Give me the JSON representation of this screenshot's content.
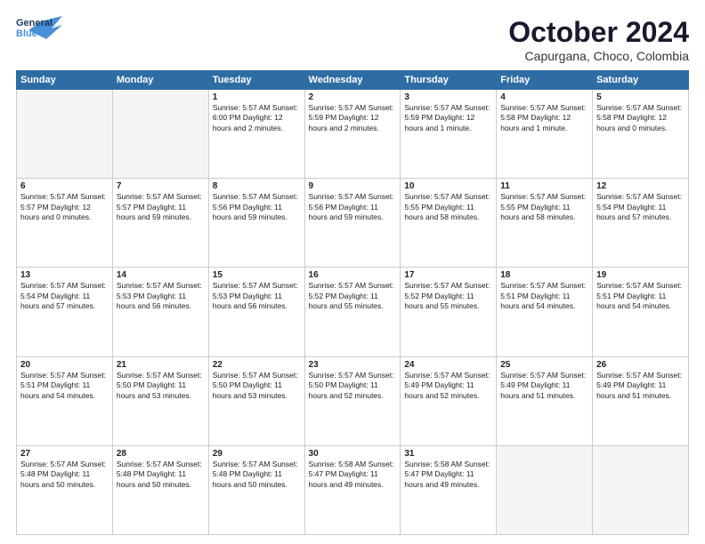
{
  "header": {
    "logo_general": "General",
    "logo_blue": "Blue",
    "month": "October 2024",
    "location": "Capurgana, Choco, Colombia"
  },
  "days_of_week": [
    "Sunday",
    "Monday",
    "Tuesday",
    "Wednesday",
    "Thursday",
    "Friday",
    "Saturday"
  ],
  "weeks": [
    [
      {
        "day": "",
        "info": ""
      },
      {
        "day": "",
        "info": ""
      },
      {
        "day": "1",
        "info": "Sunrise: 5:57 AM\nSunset: 6:00 PM\nDaylight: 12 hours\nand 2 minutes."
      },
      {
        "day": "2",
        "info": "Sunrise: 5:57 AM\nSunset: 5:59 PM\nDaylight: 12 hours\nand 2 minutes."
      },
      {
        "day": "3",
        "info": "Sunrise: 5:57 AM\nSunset: 5:59 PM\nDaylight: 12 hours\nand 1 minute."
      },
      {
        "day": "4",
        "info": "Sunrise: 5:57 AM\nSunset: 5:58 PM\nDaylight: 12 hours\nand 1 minute."
      },
      {
        "day": "5",
        "info": "Sunrise: 5:57 AM\nSunset: 5:58 PM\nDaylight: 12 hours\nand 0 minutes."
      }
    ],
    [
      {
        "day": "6",
        "info": "Sunrise: 5:57 AM\nSunset: 5:57 PM\nDaylight: 12 hours\nand 0 minutes."
      },
      {
        "day": "7",
        "info": "Sunrise: 5:57 AM\nSunset: 5:57 PM\nDaylight: 11 hours\nand 59 minutes."
      },
      {
        "day": "8",
        "info": "Sunrise: 5:57 AM\nSunset: 5:56 PM\nDaylight: 11 hours\nand 59 minutes."
      },
      {
        "day": "9",
        "info": "Sunrise: 5:57 AM\nSunset: 5:56 PM\nDaylight: 11 hours\nand 59 minutes."
      },
      {
        "day": "10",
        "info": "Sunrise: 5:57 AM\nSunset: 5:55 PM\nDaylight: 11 hours\nand 58 minutes."
      },
      {
        "day": "11",
        "info": "Sunrise: 5:57 AM\nSunset: 5:55 PM\nDaylight: 11 hours\nand 58 minutes."
      },
      {
        "day": "12",
        "info": "Sunrise: 5:57 AM\nSunset: 5:54 PM\nDaylight: 11 hours\nand 57 minutes."
      }
    ],
    [
      {
        "day": "13",
        "info": "Sunrise: 5:57 AM\nSunset: 5:54 PM\nDaylight: 11 hours\nand 57 minutes."
      },
      {
        "day": "14",
        "info": "Sunrise: 5:57 AM\nSunset: 5:53 PM\nDaylight: 11 hours\nand 56 minutes."
      },
      {
        "day": "15",
        "info": "Sunrise: 5:57 AM\nSunset: 5:53 PM\nDaylight: 11 hours\nand 56 minutes."
      },
      {
        "day": "16",
        "info": "Sunrise: 5:57 AM\nSunset: 5:52 PM\nDaylight: 11 hours\nand 55 minutes."
      },
      {
        "day": "17",
        "info": "Sunrise: 5:57 AM\nSunset: 5:52 PM\nDaylight: 11 hours\nand 55 minutes."
      },
      {
        "day": "18",
        "info": "Sunrise: 5:57 AM\nSunset: 5:51 PM\nDaylight: 11 hours\nand 54 minutes."
      },
      {
        "day": "19",
        "info": "Sunrise: 5:57 AM\nSunset: 5:51 PM\nDaylight: 11 hours\nand 54 minutes."
      }
    ],
    [
      {
        "day": "20",
        "info": "Sunrise: 5:57 AM\nSunset: 5:51 PM\nDaylight: 11 hours\nand 54 minutes."
      },
      {
        "day": "21",
        "info": "Sunrise: 5:57 AM\nSunset: 5:50 PM\nDaylight: 11 hours\nand 53 minutes."
      },
      {
        "day": "22",
        "info": "Sunrise: 5:57 AM\nSunset: 5:50 PM\nDaylight: 11 hours\nand 53 minutes."
      },
      {
        "day": "23",
        "info": "Sunrise: 5:57 AM\nSunset: 5:50 PM\nDaylight: 11 hours\nand 52 minutes."
      },
      {
        "day": "24",
        "info": "Sunrise: 5:57 AM\nSunset: 5:49 PM\nDaylight: 11 hours\nand 52 minutes."
      },
      {
        "day": "25",
        "info": "Sunrise: 5:57 AM\nSunset: 5:49 PM\nDaylight: 11 hours\nand 51 minutes."
      },
      {
        "day": "26",
        "info": "Sunrise: 5:57 AM\nSunset: 5:49 PM\nDaylight: 11 hours\nand 51 minutes."
      }
    ],
    [
      {
        "day": "27",
        "info": "Sunrise: 5:57 AM\nSunset: 5:48 PM\nDaylight: 11 hours\nand 50 minutes."
      },
      {
        "day": "28",
        "info": "Sunrise: 5:57 AM\nSunset: 5:48 PM\nDaylight: 11 hours\nand 50 minutes."
      },
      {
        "day": "29",
        "info": "Sunrise: 5:57 AM\nSunset: 5:48 PM\nDaylight: 11 hours\nand 50 minutes."
      },
      {
        "day": "30",
        "info": "Sunrise: 5:58 AM\nSunset: 5:47 PM\nDaylight: 11 hours\nand 49 minutes."
      },
      {
        "day": "31",
        "info": "Sunrise: 5:58 AM\nSunset: 5:47 PM\nDaylight: 11 hours\nand 49 minutes."
      },
      {
        "day": "",
        "info": ""
      },
      {
        "day": "",
        "info": ""
      }
    ]
  ]
}
